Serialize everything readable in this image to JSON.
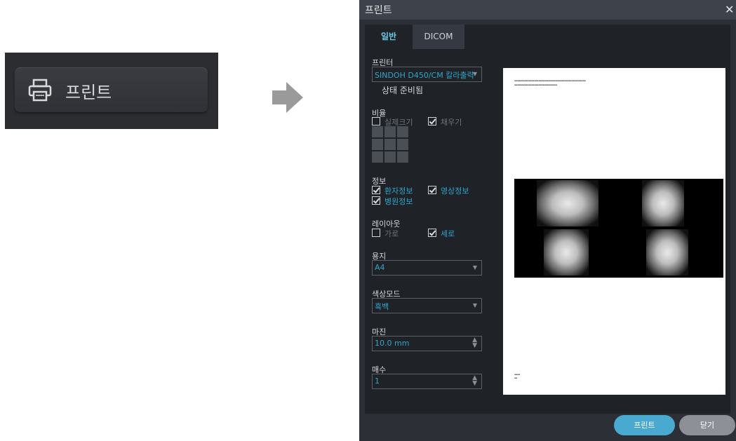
{
  "illustration": {
    "button_label": "프린트",
    "icon": "printer-icon",
    "arrow_icon": "arrow-right-icon"
  },
  "dialog": {
    "title": "프린트",
    "close_glyph": "✕",
    "tabs": [
      {
        "label": "일반",
        "active": true
      },
      {
        "label": "DICOM",
        "active": false
      }
    ],
    "printer": {
      "label": "프린터",
      "selected": "SINDOH D450/CM 칼라출력",
      "status": "상태 준비됨"
    },
    "ratio": {
      "label": "비율",
      "actual_size": {
        "label": "실제크기",
        "checked": false
      },
      "fill": {
        "label": "채우기",
        "checked": true
      }
    },
    "info": {
      "label": "정보",
      "patient_info": {
        "label": "환자정보",
        "checked": true
      },
      "image_info": {
        "label": "영상정보",
        "checked": true
      },
      "hospital_info": {
        "label": "병원정보",
        "checked": true
      }
    },
    "layout": {
      "label": "레이아웃",
      "landscape": {
        "label": "가로",
        "checked": false
      },
      "portrait": {
        "label": "세로",
        "checked": true
      }
    },
    "paper": {
      "label": "용지",
      "selected": "A4"
    },
    "color_mode": {
      "label": "색상모드",
      "selected": "흑백"
    },
    "margin": {
      "label": "마진",
      "value": "10.0 mm"
    },
    "copies": {
      "label": "매수",
      "value": "1"
    },
    "buttons": {
      "print": "프린트",
      "close": "닫기"
    },
    "colors": {
      "accent": "#2fa6cc",
      "print_button": "#4aa9cf",
      "close_button": "#8d9197",
      "background": "#2c2f35"
    }
  }
}
